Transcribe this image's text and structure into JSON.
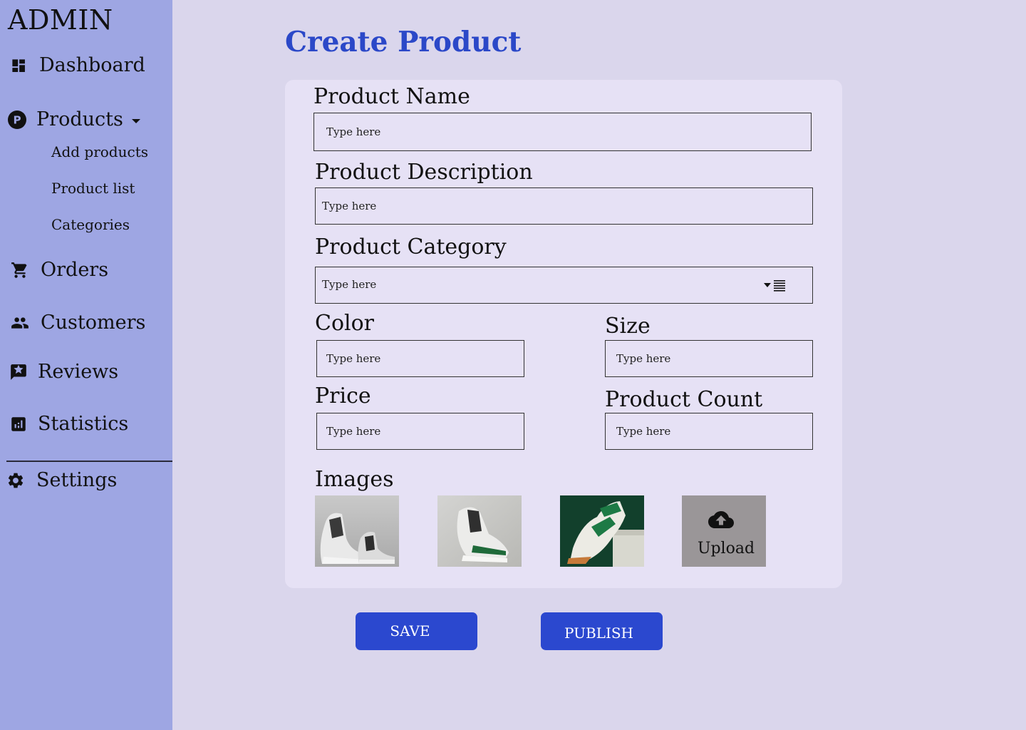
{
  "sidebar": {
    "brand": "ADMIN",
    "dashboard": "Dashboard",
    "products": "Products",
    "add_products": "Add products",
    "product_list": "Product list",
    "categories": "Categories",
    "orders": "Orders",
    "customers": "Customers",
    "reviews": "Reviews",
    "statistics": "Statistics",
    "settings": "Settings"
  },
  "page": {
    "title": "Create Product"
  },
  "form": {
    "product_name": {
      "label": "Product Name",
      "placeholder": "Type here"
    },
    "product_description": {
      "label": "Product Description",
      "placeholder": "Type here"
    },
    "product_category": {
      "label": "Product Category",
      "placeholder": "Type here"
    },
    "color": {
      "label": "Color",
      "placeholder": "Type here"
    },
    "size": {
      "label": "Size",
      "placeholder": "Type here"
    },
    "price": {
      "label": "Price",
      "placeholder": "Type here"
    },
    "product_count": {
      "label": "Product Count",
      "placeholder": "Type here"
    },
    "images": {
      "label": "Images",
      "upload_label": "Upload"
    }
  },
  "actions": {
    "save": "SAVE",
    "publish": "PUBLISH"
  },
  "colors": {
    "sidebar_bg": "#9ea6e3",
    "page_bg": "#dad6ec",
    "card_bg": "#e6e1f5",
    "accent": "#2b48cf"
  }
}
